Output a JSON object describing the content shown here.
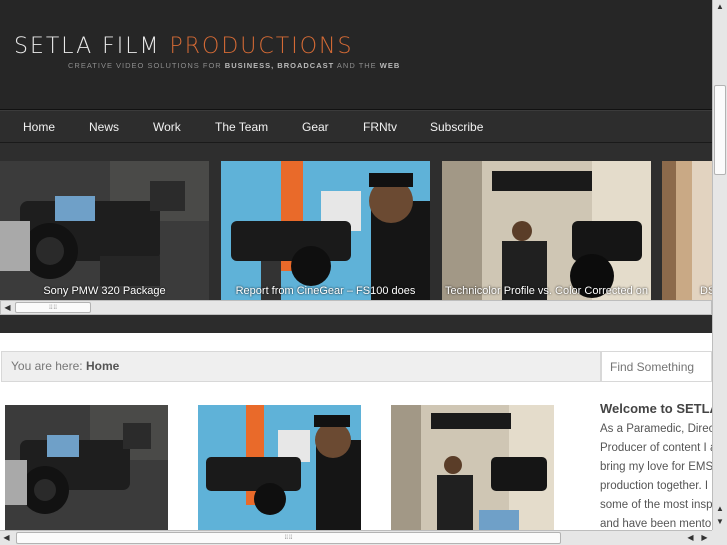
{
  "header": {
    "logo_white": "SETLA FILM",
    "logo_orange": "PRODUCTIONS",
    "tagline_pre": "CREATIVE VIDEO SOLUTIONS FOR ",
    "tagline_bold": "BUSINESS, BROADCAST",
    "tagline_mid": " AND THE ",
    "tagline_end": "WEB"
  },
  "nav": {
    "items": [
      {
        "label": "Home"
      },
      {
        "label": "News"
      },
      {
        "label": "Work"
      },
      {
        "label": "The Team"
      },
      {
        "label": "Gear"
      },
      {
        "label": "FRNtv"
      },
      {
        "label": "Subscribe"
      }
    ]
  },
  "slider": {
    "slides": [
      {
        "caption": "Sony PMW 320 Package"
      },
      {
        "caption": "Report from CineGear – FS100 does"
      },
      {
        "caption": "Technicolor Profile vs. Color Corrected on"
      },
      {
        "caption": "DS"
      }
    ]
  },
  "breadcrumb": {
    "prefix": "You are here: ",
    "current": "Home"
  },
  "search": {
    "placeholder": "Find Something"
  },
  "sidebar": {
    "title": "Welcome to SETLA",
    "lines": [
      "As a Paramedic, Director",
      "Producer of content I am",
      "bring my love for EMS and",
      "production together. I have",
      "some of the most inspiring",
      "and have been mentored"
    ]
  },
  "colors": {
    "header_bg": "#262626",
    "logo_orange": "#d46a35",
    "nav_bg": "#2d2d2d"
  }
}
